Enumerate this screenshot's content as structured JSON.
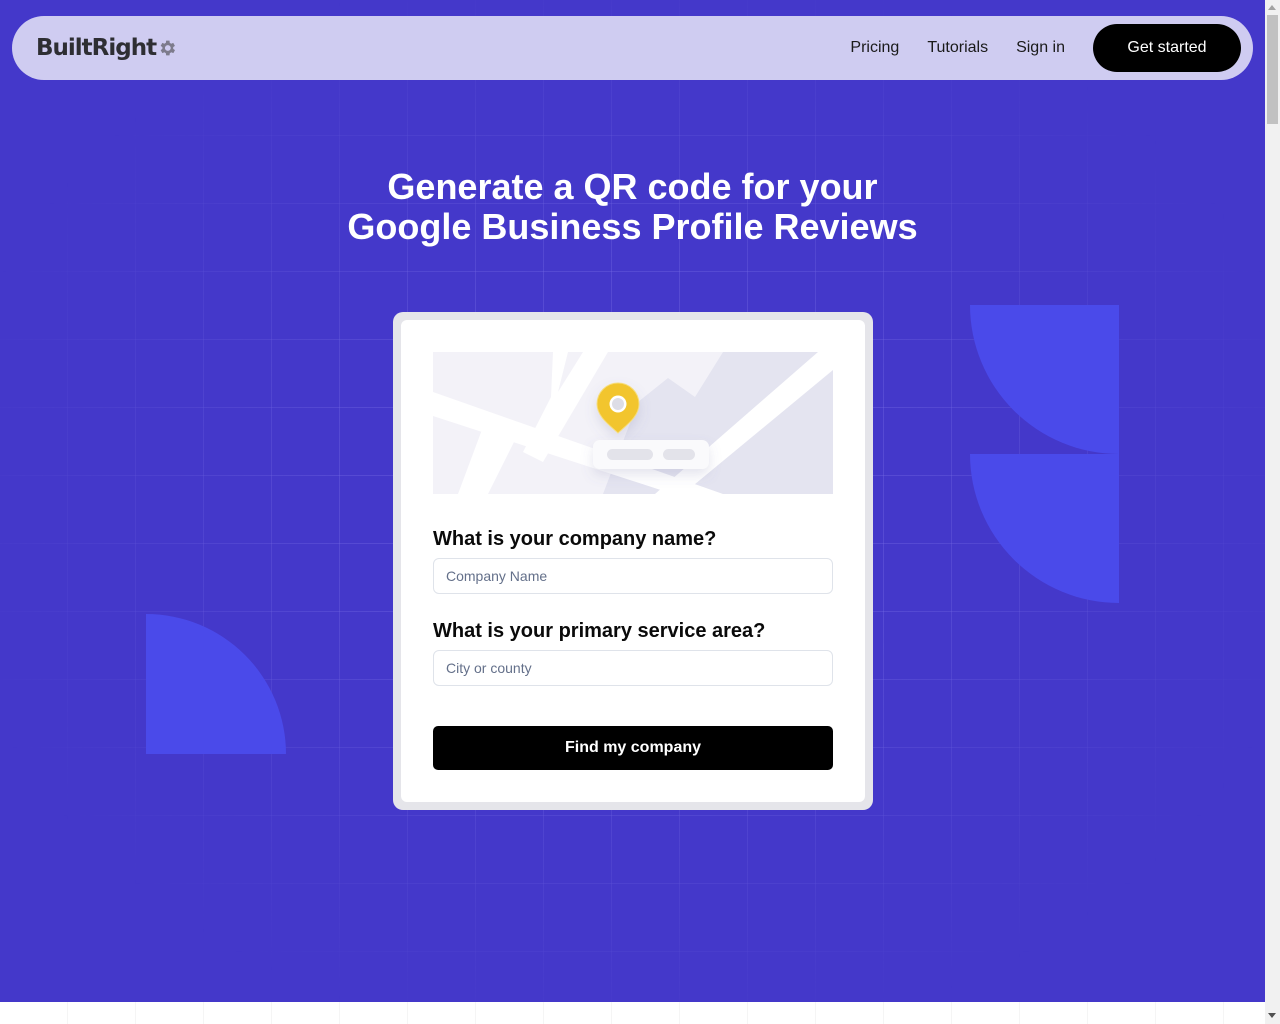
{
  "navbar": {
    "logo_text": "BuiltRight",
    "logo_icon": "gear-icon",
    "links": [
      {
        "label": "Pricing"
      },
      {
        "label": "Tutorials"
      },
      {
        "label": "Sign in"
      }
    ],
    "cta_label": "Get started"
  },
  "hero": {
    "headline_line1": "Generate a QR code for your",
    "headline_line2": "Google Business Profile Reviews"
  },
  "form": {
    "illustration": "map-with-location-pin",
    "company_question": "What is your company name?",
    "company_placeholder": "Company Name",
    "company_value": "",
    "area_question": "What is your primary service area?",
    "area_placeholder": "City or county",
    "area_value": "",
    "submit_label": "Find my company"
  },
  "colors": {
    "hero_background": "#4438ca",
    "accent_shapes": "#4a4aea",
    "navbar_background": "#cfccf1",
    "pin": "#f2c52d",
    "button": "#000000"
  }
}
